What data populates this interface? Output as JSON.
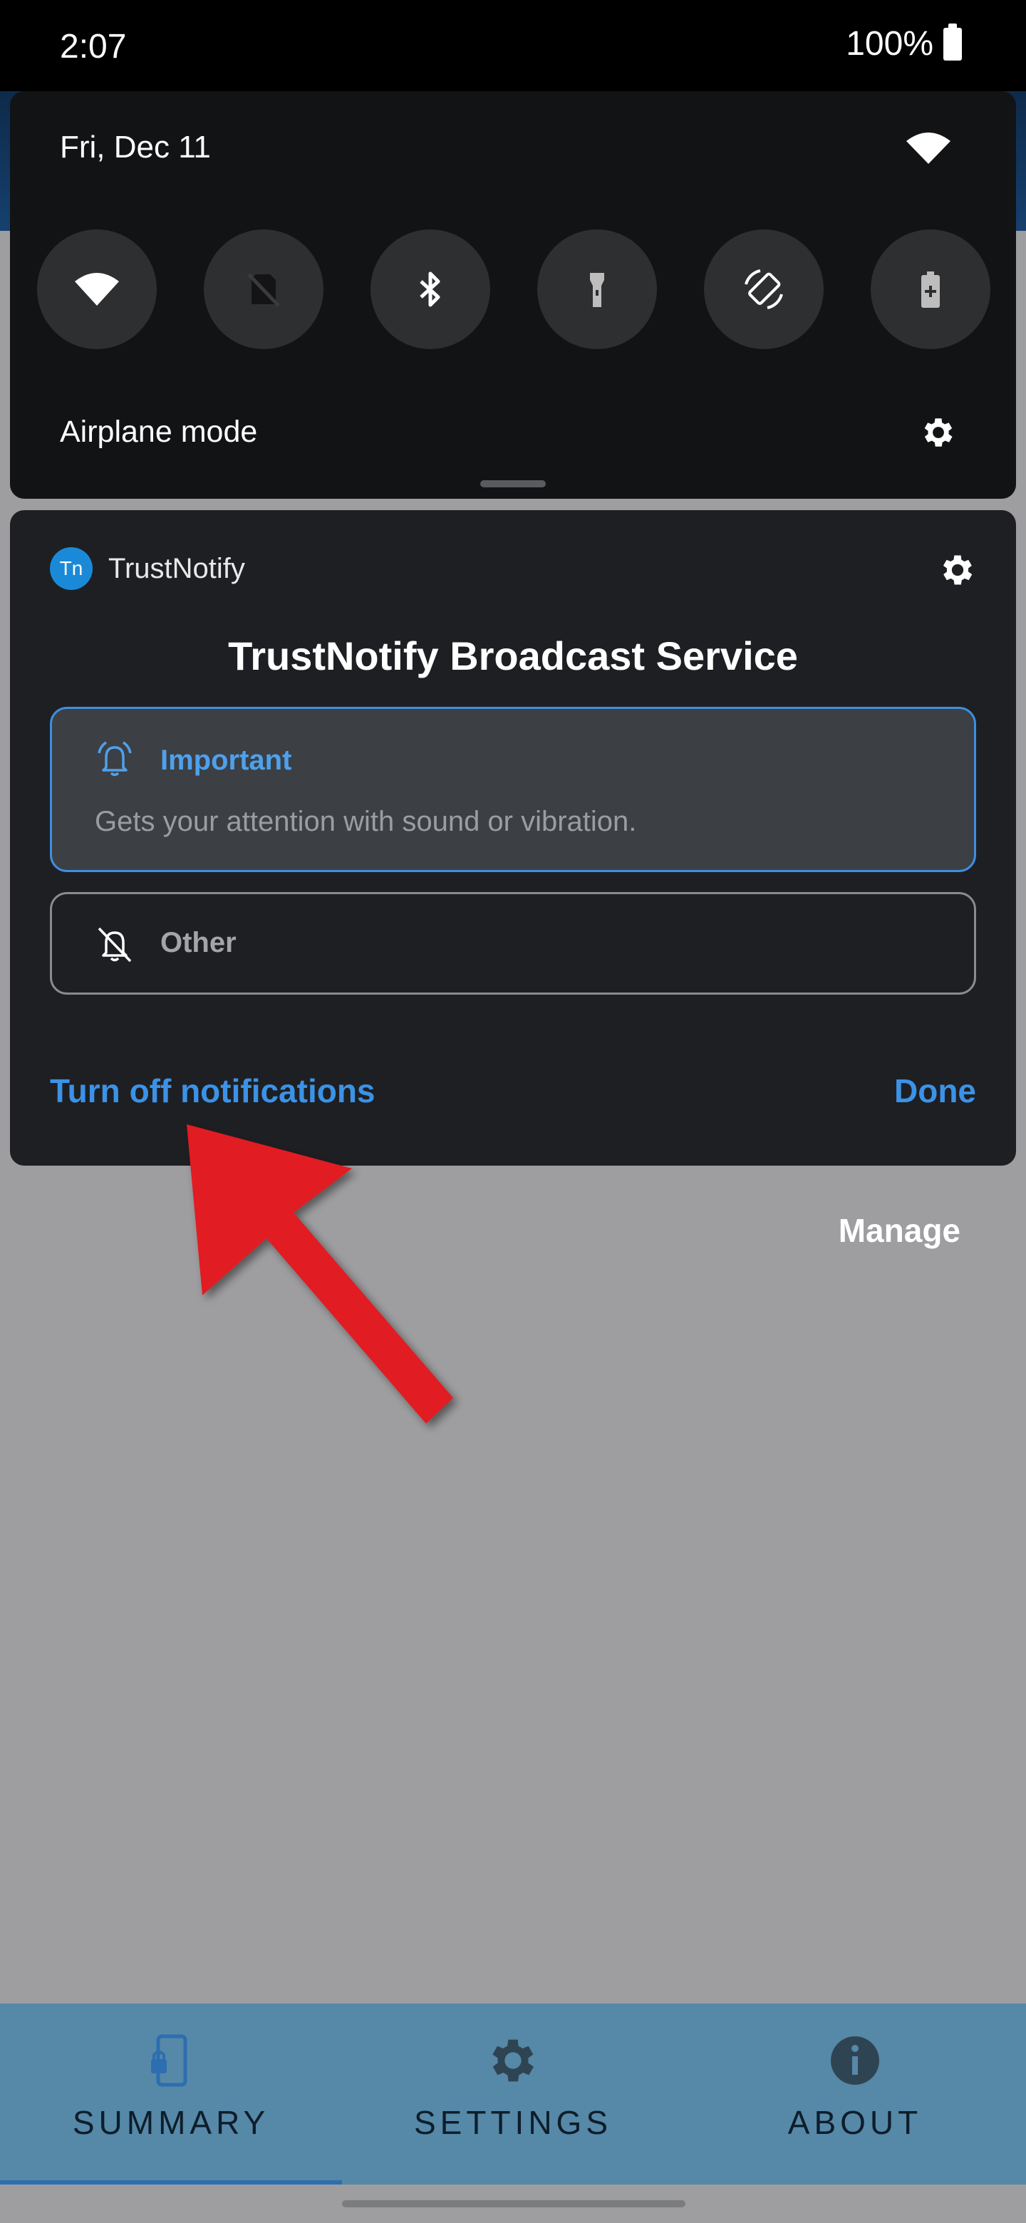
{
  "status_bar": {
    "time": "2:07",
    "battery": "100%"
  },
  "quick_settings": {
    "date": "Fri, Dec 11",
    "tiles": [
      {
        "icon": "wifi-icon",
        "active": true
      },
      {
        "icon": "no-sim-icon",
        "active": false
      },
      {
        "icon": "bluetooth-icon",
        "active": true
      },
      {
        "icon": "flashlight-icon",
        "active": false
      },
      {
        "icon": "auto-rotate-icon",
        "active": true
      },
      {
        "icon": "battery-saver-icon",
        "active": false
      }
    ],
    "label": "Airplane mode"
  },
  "notification": {
    "app_name": "TrustNotify",
    "app_icon_text": "Tn",
    "title": "TrustNotify Broadcast Service",
    "options": {
      "important": {
        "label": "Important",
        "description": "Gets your attention with sound or vibration."
      },
      "other": {
        "label": "Other"
      }
    },
    "turn_off_label": "Turn off notifications",
    "done_label": "Done"
  },
  "manage_label": "Manage",
  "bottom_nav": {
    "items": [
      {
        "label": "SUMMARY",
        "icon": "phone-lock-icon",
        "selected": true
      },
      {
        "label": "SETTINGS",
        "icon": "gear-icon",
        "selected": false
      },
      {
        "label": "ABOUT",
        "icon": "info-icon",
        "selected": false
      }
    ]
  },
  "colors": {
    "accent_blue": "#2c8ee8",
    "link_blue": "#3b92e6",
    "annotation_red": "#e11d22",
    "nav_background": "#5688a8"
  }
}
